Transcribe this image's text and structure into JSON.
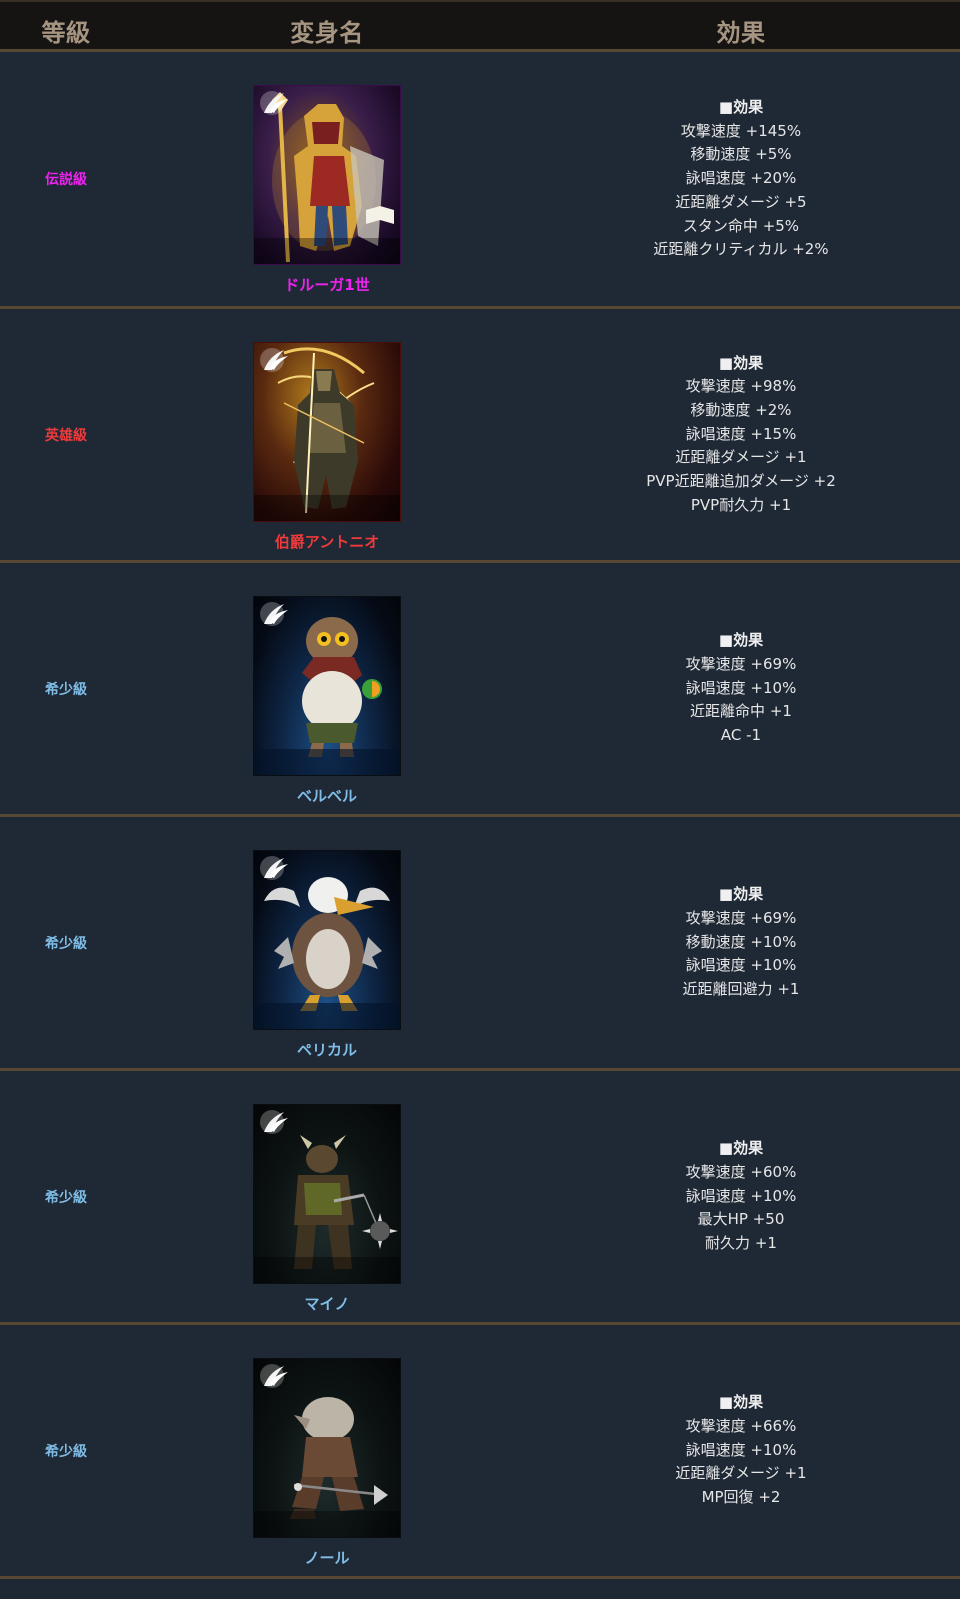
{
  "header": {
    "grade": "等級",
    "name": "変身名",
    "effect": "効果"
  },
  "colors": {
    "legend": "#ee22ee",
    "hero": "#ee3a3a",
    "rare": "#7fbde6"
  },
  "rows": [
    {
      "grade": "伝説級",
      "grade_color": "#ee22ee",
      "name": "ドルーガ1世",
      "effect_title": "■効果",
      "effects": [
        "攻撃速度 +145%",
        "移動速度 +5%",
        "詠唱速度 +20%",
        "近距離ダメージ +5",
        "スタン命中 +5%",
        "近距離クリティカル +2%"
      ]
    },
    {
      "grade": "英雄級",
      "grade_color": "#ee3a3a",
      "name": "伯爵アントニオ",
      "effect_title": "■効果",
      "effects": [
        "攻撃速度 +98%",
        "移動速度 +2%",
        "詠唱速度 +15%",
        "近距離ダメージ +1",
        "PVP近距離追加ダメージ +2",
        "PVP耐久力 +1"
      ]
    },
    {
      "grade": "希少級",
      "grade_color": "#7fbde6",
      "name": "ベルベル",
      "effect_title": "■効果",
      "effects": [
        "攻撃速度 +69%",
        "詠唱速度 +10%",
        "近距離命中 +1",
        "AC -1"
      ]
    },
    {
      "grade": "希少級",
      "grade_color": "#7fbde6",
      "name": "ペリカル",
      "effect_title": "■効果",
      "effects": [
        "攻撃速度 +69%",
        "移動速度 +10%",
        "詠唱速度 +10%",
        "近距離回避力 +1"
      ]
    },
    {
      "grade": "希少級",
      "grade_color": "#7fbde6",
      "name": "マイノ",
      "effect_title": "■効果",
      "effects": [
        "攻撃速度 +60%",
        "詠唱速度 +10%",
        "最大HP +50",
        "耐久力 +1"
      ]
    },
    {
      "grade": "希少級",
      "grade_color": "#7fbde6",
      "name": "ノール",
      "effect_title": "■効果",
      "effects": [
        "攻撃速度 +66%",
        "詠唱速度 +10%",
        "近距離ダメージ +1",
        "MP回復 +2"
      ]
    }
  ]
}
